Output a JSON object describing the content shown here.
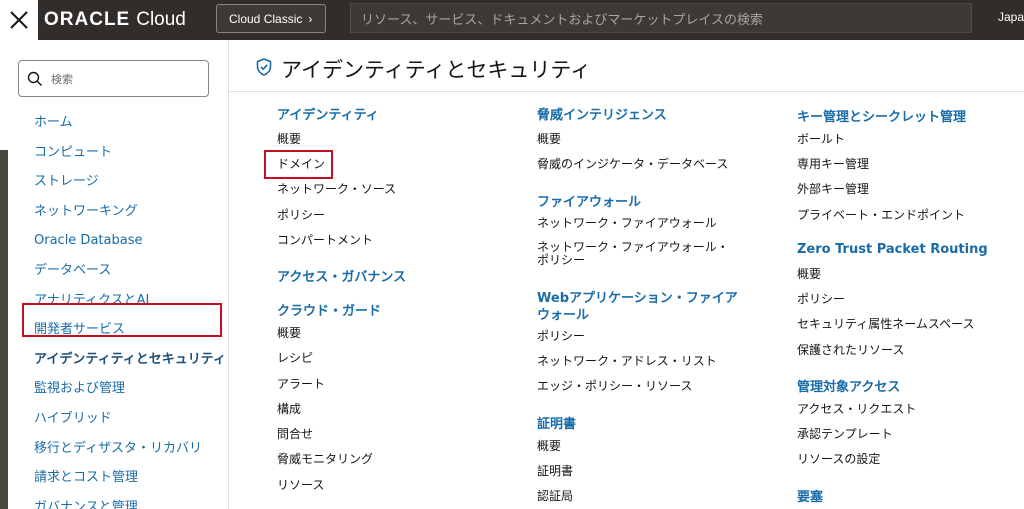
{
  "topbar": {
    "logo_oracle": "ORACLE",
    "logo_cloud": "Cloud",
    "classic_label": "Cloud Classic",
    "classic_chevron": "›",
    "search_placeholder": "リソース、サービス、ドキュメントおよびマーケットプレイスの検索",
    "lang": "Japa"
  },
  "sidebar": {
    "search_placeholder": "検索",
    "items": [
      {
        "label": "ホーム"
      },
      {
        "label": "コンピュート"
      },
      {
        "label": "ストレージ"
      },
      {
        "label": "ネットワーキング"
      },
      {
        "label": "Oracle Database"
      },
      {
        "label": "データベース"
      },
      {
        "label": "アナリティクスとAI"
      },
      {
        "label": "開発者サービス"
      },
      {
        "label": "アイデンティティとセキュリティ"
      },
      {
        "label": "監視および管理"
      },
      {
        "label": "ハイブリッド"
      },
      {
        "label": "移行とディザスタ・リカバリ"
      },
      {
        "label": "請求とコスト管理"
      },
      {
        "label": "ガバナンスと管理"
      }
    ]
  },
  "main": {
    "title": "アイデンティティとセキュリティ",
    "col1": {
      "g1_title": "アイデンティティ",
      "g1_items": [
        "概要",
        "ドメイン",
        "ネットワーク・ソース",
        "ポリシー",
        "コンパートメント"
      ],
      "g2_title": "アクセス・ガバナンス",
      "g3_title": "クラウド・ガード",
      "g3_items": [
        "概要",
        "レシピ",
        "アラート",
        "構成",
        "問合せ",
        "脅威モニタリング",
        "リソース"
      ]
    },
    "col2": {
      "g1_title": "脅威インテリジェンス",
      "g1_items": [
        "概要",
        "脅威のインジケータ・データベース"
      ],
      "g2_title": "ファイアウォール",
      "g2_items": [
        "ネットワーク・ファイアウォール",
        "ネットワーク・ファイアウォール・",
        "ポリシー"
      ],
      "g3_title_1": "Webアプリケーション・ファイア",
      "g3_title_2": "ウォール",
      "g3_items": [
        "ポリシー",
        "ネットワーク・アドレス・リスト",
        "エッジ・ポリシー・リソース"
      ],
      "g4_title": "証明書",
      "g4_items": [
        "概要",
        "証明書",
        "認証局"
      ]
    },
    "col3": {
      "g1_title": "キー管理とシークレット管理",
      "g1_items": [
        "ボールト",
        "専用キー管理",
        "外部キー管理",
        "プライベート・エンドポイント"
      ],
      "g2_title": "Zero Trust Packet Routing",
      "g2_items": [
        "概要",
        "ポリシー",
        "セキュリティ属性ネームスペース",
        "保護されたリソース"
      ],
      "g3_title": "管理対象アクセス",
      "g3_items": [
        "アクセス・リクエスト",
        "承認テンプレート",
        "リソースの設定"
      ],
      "g4_title": "要塞"
    }
  },
  "colors": {
    "topbar_bg": "#312d2a",
    "link_blue": "#1a6ca8",
    "highlight_red": "#c0111f"
  },
  "icons": [
    "close-icon",
    "search-icon",
    "shield-icon",
    "chevron-right-icon"
  ]
}
